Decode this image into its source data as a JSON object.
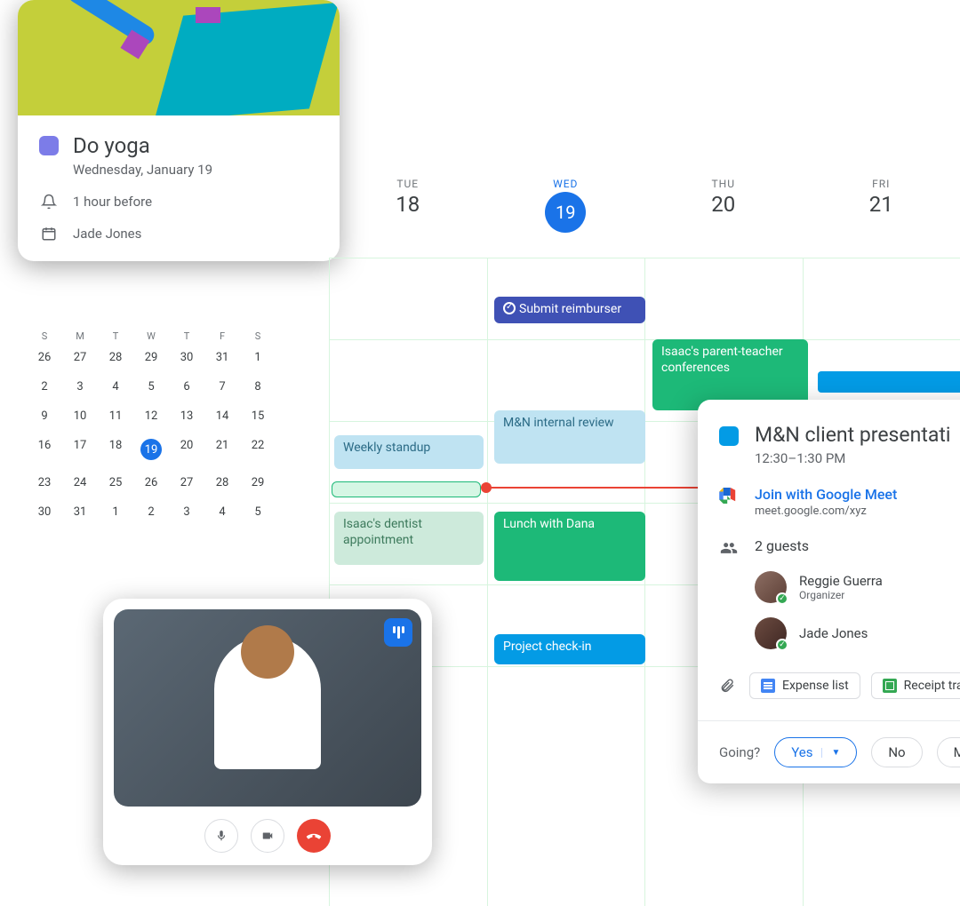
{
  "task": {
    "title": "Do yoga",
    "date": "Wednesday, January 19",
    "reminder": "1 hour before",
    "owner": "Jade Jones",
    "chip_color": "#7c7ce8"
  },
  "miniMonth": {
    "days": [
      "S",
      "M",
      "T",
      "W",
      "T",
      "F",
      "S"
    ],
    "cells": [
      "26",
      "27",
      "28",
      "29",
      "30",
      "31",
      "1",
      "2",
      "3",
      "4",
      "5",
      "6",
      "7",
      "8",
      "9",
      "10",
      "11",
      "12",
      "13",
      "14",
      "15",
      "16",
      "17",
      "18",
      "19",
      "20",
      "21",
      "22",
      "23",
      "24",
      "25",
      "26",
      "27",
      "28",
      "29",
      "30",
      "31",
      "1",
      "2",
      "3",
      "4",
      "5"
    ],
    "selected": "19"
  },
  "week": {
    "cols": [
      {
        "lbl": "TUE",
        "num": "18",
        "sel": false
      },
      {
        "lbl": "WED",
        "num": "19",
        "sel": true
      },
      {
        "lbl": "THU",
        "num": "20",
        "sel": false
      },
      {
        "lbl": "FRI",
        "num": "21",
        "sel": false
      }
    ]
  },
  "events": {
    "submit": {
      "text": "Submit reimburser"
    },
    "pt": {
      "text": "Isaac's parent-teacher conferences"
    },
    "review": {
      "text": "M&N internal review"
    },
    "standup": {
      "text": "Weekly standup"
    },
    "dentist": {
      "text": "Isaac's dentist appointment"
    },
    "lunch": {
      "text": "Lunch with Dana"
    },
    "checkin": {
      "text": "Project check-in"
    }
  },
  "detail": {
    "title": "M&N client presentati",
    "time": "12:30–1:30 PM",
    "meet_label": "Join with Google Meet",
    "meet_url": "meet.google.com/xyz",
    "guest_count": "2 guests",
    "guests": [
      {
        "name": "Reggie Guerra",
        "role": "Organizer"
      },
      {
        "name": "Jade Jones",
        "role": ""
      }
    ],
    "attachments": [
      {
        "label": "Expense list",
        "type": "doc"
      },
      {
        "label": "Receipt tra",
        "type": "sheet"
      }
    ],
    "going_label": "Going?",
    "yes": "Yes",
    "no": "No",
    "maybe": "Ma"
  }
}
